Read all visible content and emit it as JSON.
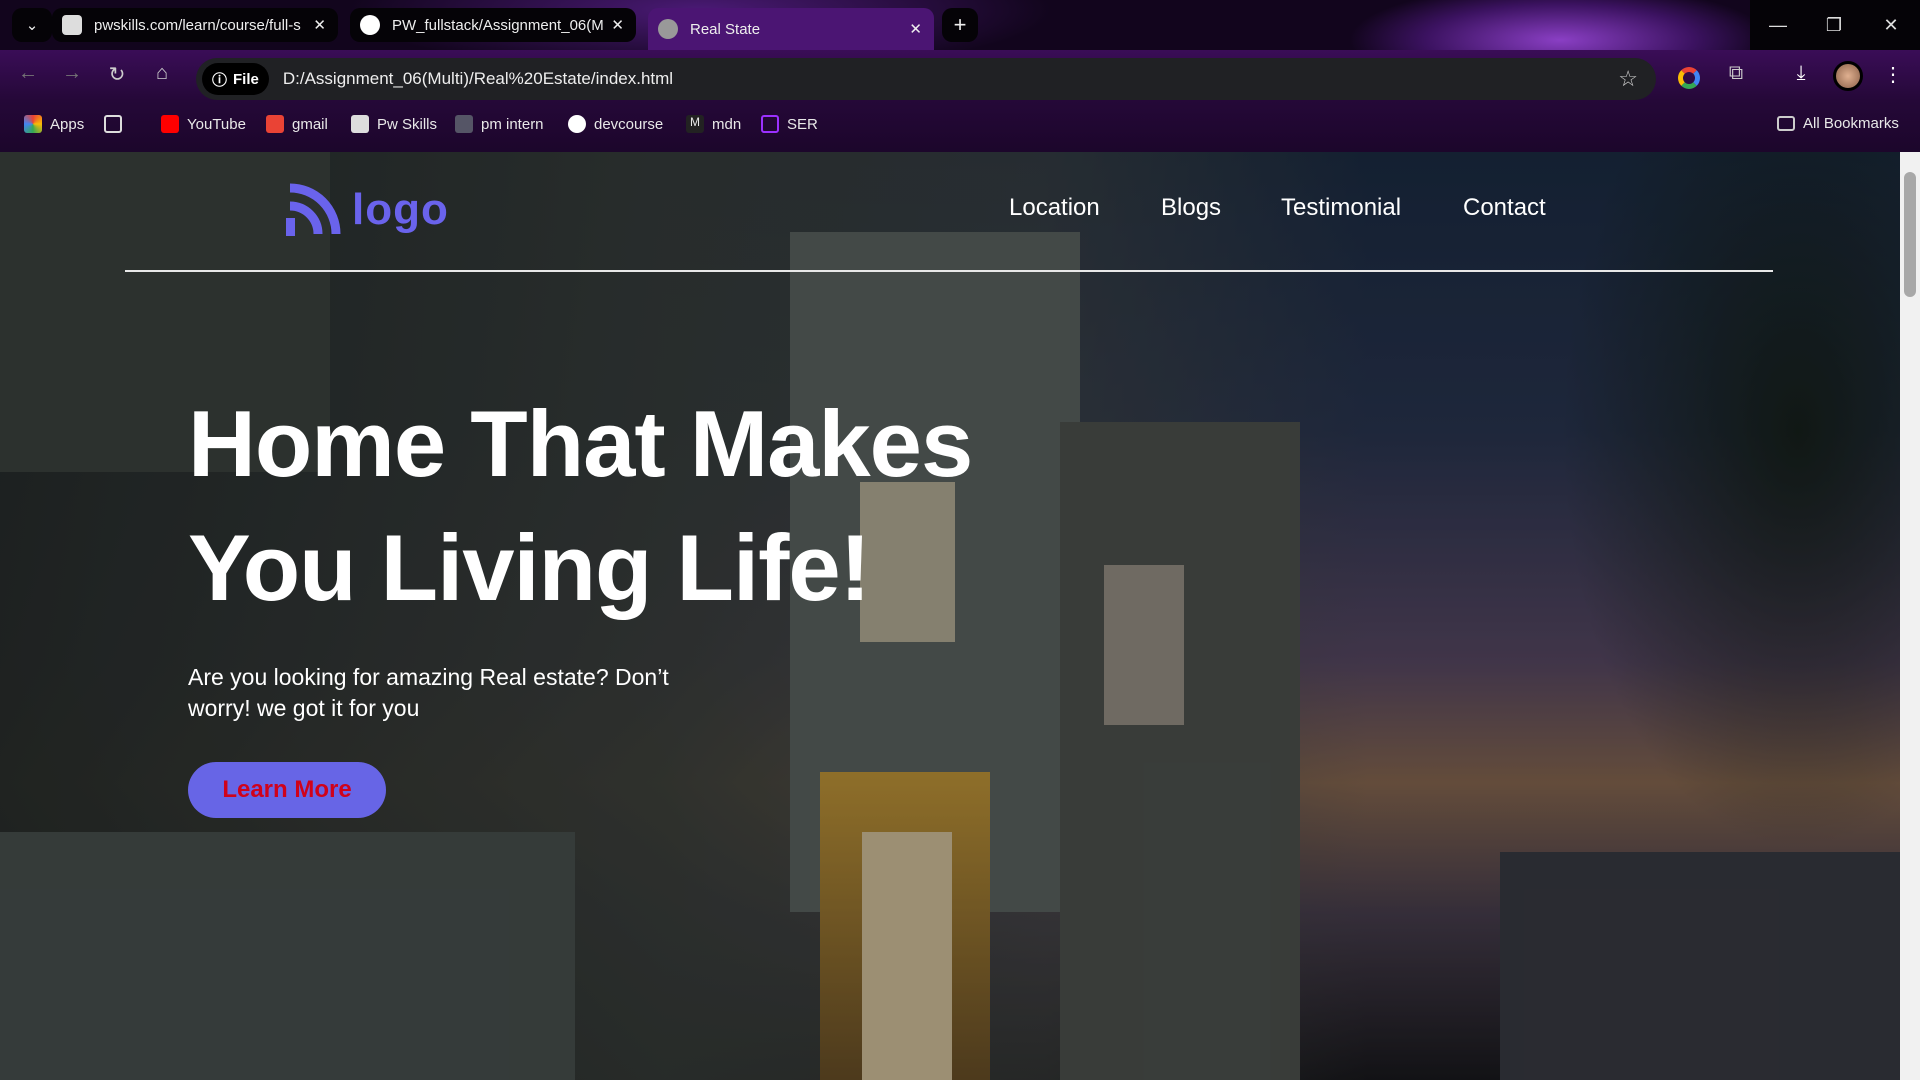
{
  "browser": {
    "tabs": [
      {
        "title": "pwskills.com/learn/course/full-s",
        "close": "✕"
      },
      {
        "title": "PW_fullstack/Assignment_06(M",
        "close": "✕"
      },
      {
        "title": "Real State",
        "close": "✕"
      }
    ],
    "new_tab": "+",
    "tab_list": "⌄",
    "window": {
      "minimize": "—",
      "restore": "❐",
      "close": "✕"
    },
    "nav": {
      "back": "←",
      "forward": "→",
      "reload": "↻",
      "home": "⌂"
    },
    "omnibox": {
      "chip": "File",
      "url": "D:/Assignment_06(Multi)/Real%20Estate/index.html",
      "star": "☆"
    },
    "toolbar": {
      "extensions": "⧉",
      "download": "⤓",
      "menu": "⋮"
    },
    "bookmarks": [
      {
        "label": "Apps",
        "color": "#e94235"
      },
      {
        "label": "YouTube",
        "color": "#ff0000"
      },
      {
        "label": "gmail",
        "color": "#ea4335"
      },
      {
        "label": "Pw Skills",
        "color": "#dddddd"
      },
      {
        "label": "pm intern",
        "color": "#8888aa"
      },
      {
        "label": "devcourse",
        "color": "#ffffff"
      },
      {
        "label": "mdn",
        "color": "#222222"
      },
      {
        "label": "SER",
        "color": "#9b30ff"
      }
    ],
    "all_bookmarks": "All Bookmarks"
  },
  "page": {
    "logo": "logo",
    "nav": [
      "Location",
      "Blogs",
      "Testimonial",
      "Contact"
    ],
    "headline": "Home That Makes You Living Life!",
    "subtext": "Are you looking for amazing Real estate? Don’t worry! we got it for you",
    "cta": "Learn More",
    "colors": {
      "accent": "#6765e6",
      "cta_text": "#d0021b"
    }
  }
}
